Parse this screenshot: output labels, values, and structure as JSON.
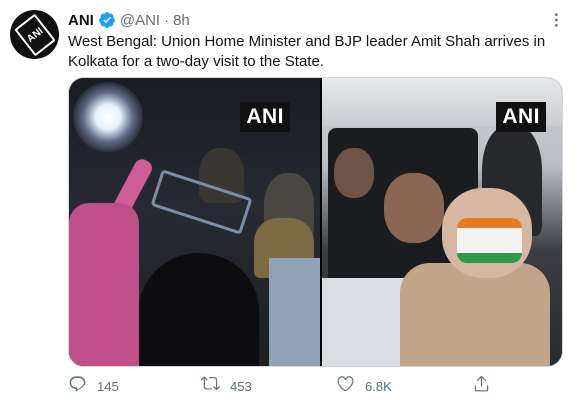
{
  "author": {
    "name": "ANI",
    "handle": "@ANI",
    "separator": "·",
    "time": "8h",
    "avatar_text": "ANI",
    "verified_icon": "verified-badge-icon"
  },
  "tweet": {
    "text": "West Bengal: Union Home Minister and BJP leader Amit Shah arrives in Kolkata for a two-day visit to the State."
  },
  "media": {
    "photos": [
      {
        "watermark": "ANI"
      },
      {
        "watermark": "ANI"
      }
    ]
  },
  "actions": {
    "reply_count": "145",
    "retweet_count": "453",
    "like_count": "6.8K",
    "icons": [
      "reply-icon",
      "retweet-icon",
      "like-icon",
      "share-icon"
    ]
  },
  "colors": {
    "text_primary": "#0f1419",
    "text_secondary": "#5b7083",
    "verified": "#1da1f2",
    "border": "#cfd9de"
  }
}
